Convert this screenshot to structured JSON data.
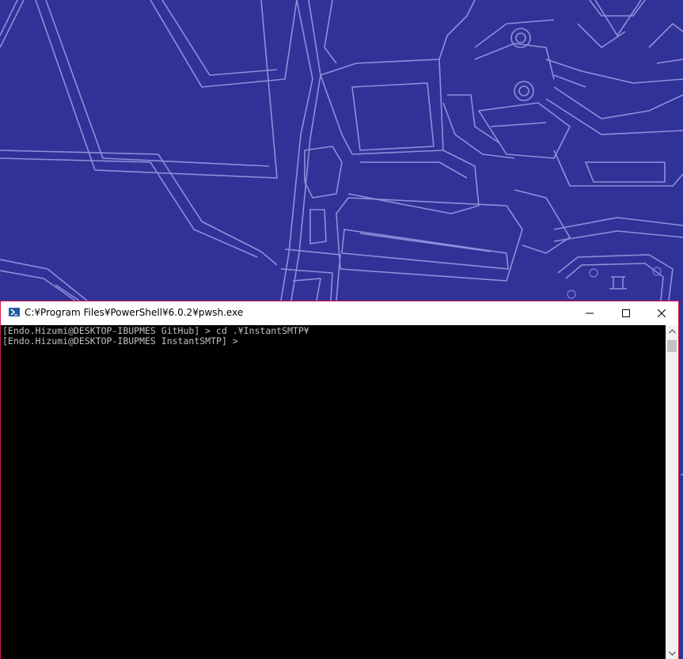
{
  "desktop": {
    "wallpaper_color": "#313297",
    "line_color": "#8e8fdc"
  },
  "window": {
    "title": "C:¥Program Files¥PowerShell¥6.0.2¥pwsh.exe",
    "icon": "powershell-icon",
    "border_color": "#d11d4b",
    "controls": {
      "minimize_icon": "minimize-icon",
      "maximize_icon": "maximize-icon",
      "close_icon": "close-icon"
    }
  },
  "console": {
    "background": "#000000",
    "foreground": "#c0c0c0",
    "lines": [
      "[Endo.Hizumi@DESKTOP-IBUPMES GitHub] > cd .¥InstantSMTP¥",
      "[Endo.Hizumi@DESKTOP-IBUPMES InstantSMTP] >"
    ]
  },
  "scrollbar": {
    "up_icon": "scroll-up-arrow-icon",
    "down_icon": "scroll-down-arrow-icon"
  }
}
